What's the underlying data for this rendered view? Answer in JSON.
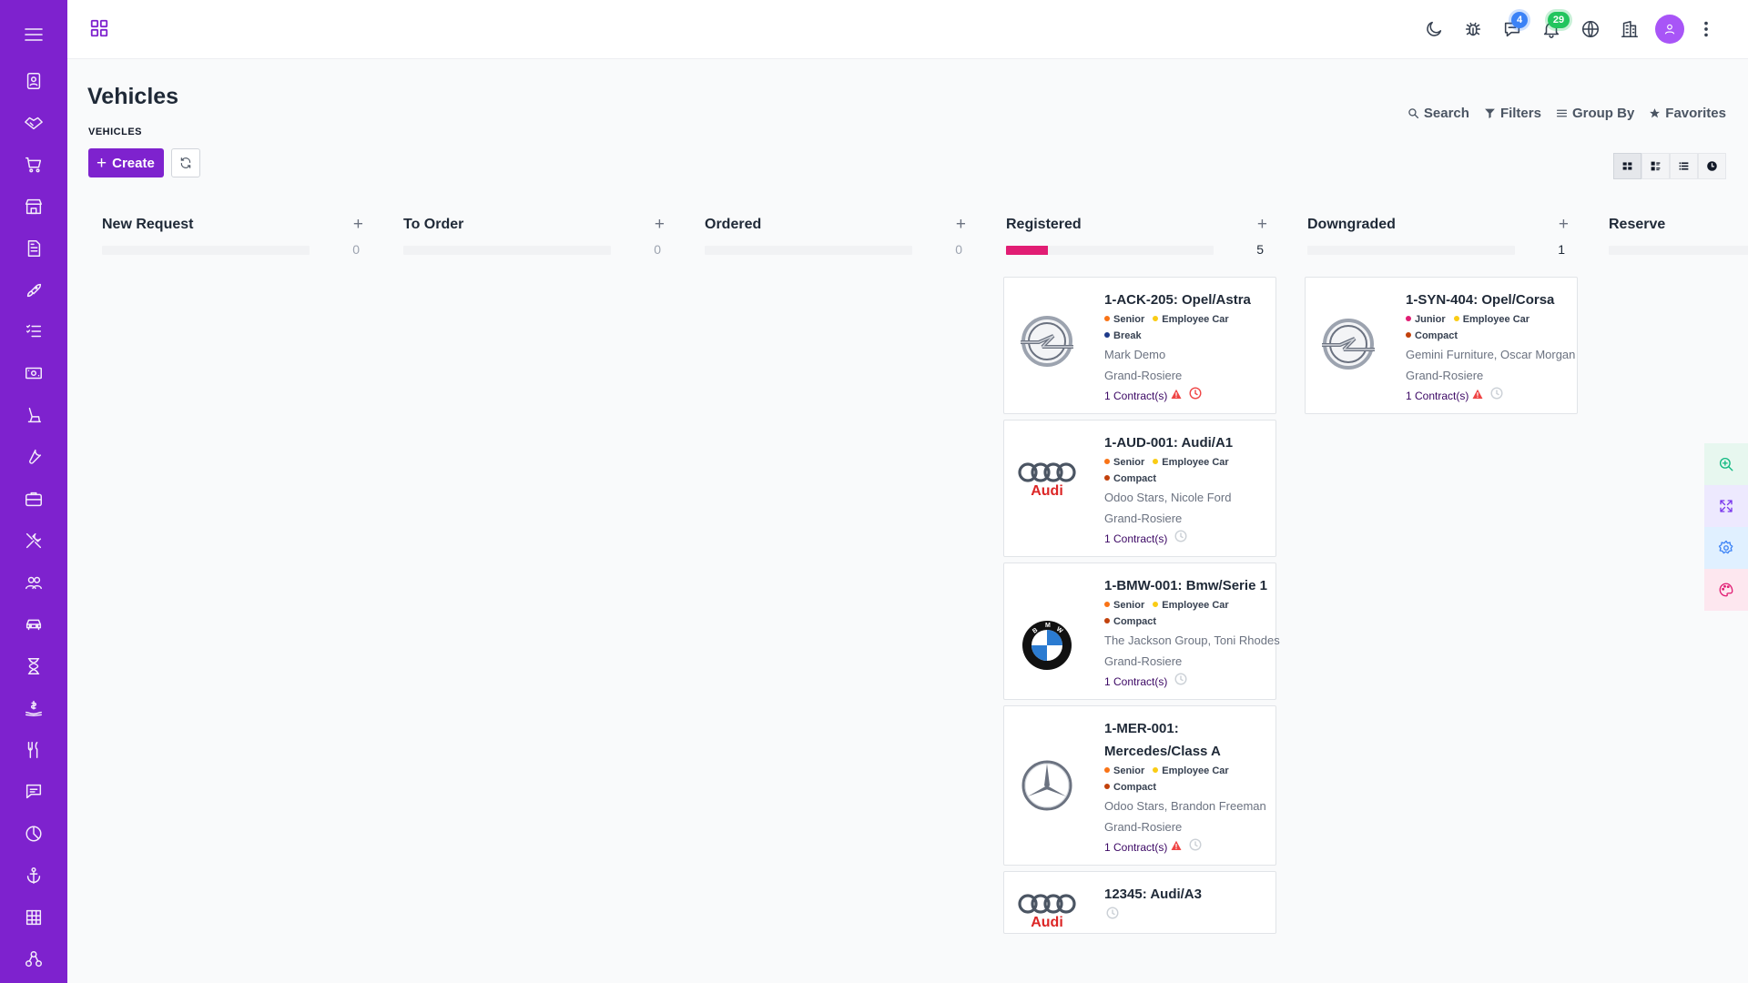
{
  "sidebar": {
    "items": [
      {
        "name": "menu-icon"
      },
      {
        "name": "contacts-icon"
      },
      {
        "name": "handshake-icon"
      },
      {
        "name": "cart-icon"
      },
      {
        "name": "store-icon"
      },
      {
        "name": "invoice-icon"
      },
      {
        "name": "rocket-icon"
      },
      {
        "name": "checklist-icon"
      },
      {
        "name": "money-icon"
      },
      {
        "name": "chair-icon"
      },
      {
        "name": "wrench-icon"
      },
      {
        "name": "briefcase-icon"
      },
      {
        "name": "tools-icon"
      },
      {
        "name": "people-icon"
      },
      {
        "name": "car-icon"
      },
      {
        "name": "hourglass-icon"
      },
      {
        "name": "payroll-icon"
      },
      {
        "name": "restaurant-icon"
      },
      {
        "name": "chat-icon"
      },
      {
        "name": "pie-chart-icon"
      },
      {
        "name": "anchor-icon"
      },
      {
        "name": "grid-icon"
      },
      {
        "name": "hierarchy-icon"
      }
    ]
  },
  "topbar": {
    "messages_badge": "4",
    "notifications_badge": "29"
  },
  "page": {
    "title": "Vehicles",
    "breadcrumb": "VEHICLES",
    "create_label": "Create"
  },
  "search_tools": {
    "search": "Search",
    "filters": "Filters",
    "group_by": "Group By",
    "favorites": "Favorites"
  },
  "colors": {
    "brand": "#7e22ce",
    "progress": "#e11d74",
    "tag_senior": "#f97316",
    "tag_junior": "#e11d74",
    "tag_employee_car": "#facc15",
    "tag_break": "#1e3a8a",
    "tag_compact": "#c2410c"
  },
  "columns": [
    {
      "title": "New Request",
      "count": "0",
      "progress": 0,
      "cards": []
    },
    {
      "title": "To Order",
      "count": "0",
      "progress": 0,
      "cards": []
    },
    {
      "title": "Ordered",
      "count": "0",
      "progress": 0,
      "cards": []
    },
    {
      "title": "Registered",
      "count": "5",
      "progress": 0.2,
      "cards": [
        {
          "title": "1-ACK-205: Opel/Astra",
          "logo": "opel-logo",
          "tags": [
            {
              "label": "Senior",
              "color": "#f97316"
            },
            {
              "label": "Employee Car",
              "color": "#facc15"
            },
            {
              "label": "Break",
              "color": "#1e3a8a"
            }
          ],
          "lines": [
            "Mark Demo",
            "Grand-Rosiere"
          ],
          "contracts": "1 Contract(s)",
          "warning": true,
          "clock": "red"
        },
        {
          "title": "1-AUD-001: Audi/A1",
          "logo": "audi-logo",
          "tags": [
            {
              "label": "Senior",
              "color": "#f97316"
            },
            {
              "label": "Employee Car",
              "color": "#facc15"
            },
            {
              "label": "Compact",
              "color": "#c2410c"
            }
          ],
          "lines": [
            "Odoo Stars, Nicole Ford",
            "Grand-Rosiere"
          ],
          "contracts": "1 Contract(s)",
          "warning": false,
          "clock": "grey"
        },
        {
          "title": "1-BMW-001: Bmw/Serie 1",
          "logo": "bmw-logo",
          "tags": [
            {
              "label": "Senior",
              "color": "#f97316"
            },
            {
              "label": "Employee Car",
              "color": "#facc15"
            },
            {
              "label": "Compact",
              "color": "#c2410c"
            }
          ],
          "lines": [
            "The Jackson Group, Toni Rhodes",
            "Grand-Rosiere"
          ],
          "contracts": "1 Contract(s)",
          "warning": false,
          "clock": "grey"
        },
        {
          "title": "1-MER-001: Mercedes/Class A",
          "logo": "mercedes-logo",
          "tags": [
            {
              "label": "Senior",
              "color": "#f97316"
            },
            {
              "label": "Employee Car",
              "color": "#facc15"
            },
            {
              "label": "Compact",
              "color": "#c2410c"
            }
          ],
          "lines": [
            "Odoo Stars, Brandon Freeman",
            "Grand-Rosiere"
          ],
          "contracts": "1 Contract(s)",
          "warning": true,
          "clock": "grey"
        },
        {
          "title": "12345: Audi/A3",
          "logo": "audi-logo",
          "tags": [],
          "lines": [],
          "contracts": "",
          "warning": false,
          "clock": "grey"
        }
      ]
    },
    {
      "title": "Downgraded",
      "count": "1",
      "progress": 0,
      "cards": [
        {
          "title": "1-SYN-404: Opel/Corsa",
          "logo": "opel-logo",
          "tags": [
            {
              "label": "Junior",
              "color": "#e11d74"
            },
            {
              "label": "Employee Car",
              "color": "#facc15"
            },
            {
              "label": "Compact",
              "color": "#c2410c"
            }
          ],
          "lines": [
            "Gemini Furniture, Oscar Morgan",
            "Grand-Rosiere"
          ],
          "contracts": "1 Contract(s)",
          "warning": true,
          "clock": "grey"
        }
      ]
    },
    {
      "title": "Reserve",
      "count": "",
      "progress": 0,
      "cards": []
    }
  ]
}
